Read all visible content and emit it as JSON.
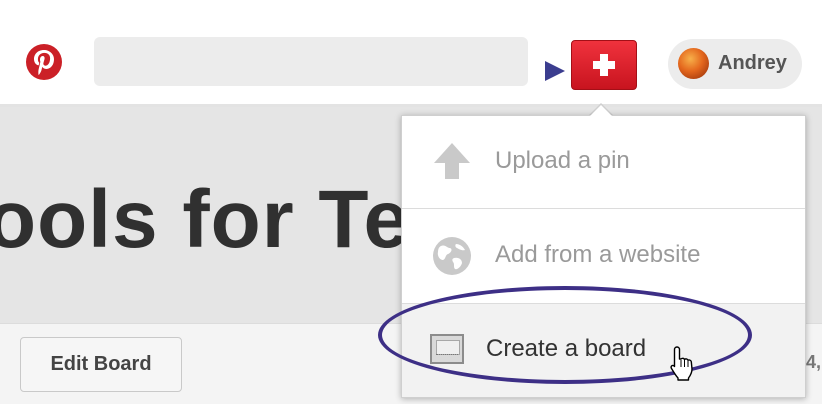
{
  "header": {
    "logo_icon": "pinterest-logo",
    "search": {
      "value": "",
      "placeholder": ""
    },
    "add_button_icon": "plus-icon",
    "user": {
      "name": "Andrey"
    }
  },
  "board": {
    "title_fragment": "ools for Te",
    "edit_label": "Edit Board",
    "right_fragment": "4,"
  },
  "dropdown": {
    "items": [
      {
        "label": "Upload a pin",
        "icon": "upload-arrow-icon"
      },
      {
        "label": "Add from a website",
        "icon": "globe-icon"
      },
      {
        "label": "Create a board",
        "icon": "board-icon"
      }
    ]
  },
  "colors": {
    "brand_red": "#cb2027",
    "annotation_blue": "#3d2f86"
  }
}
